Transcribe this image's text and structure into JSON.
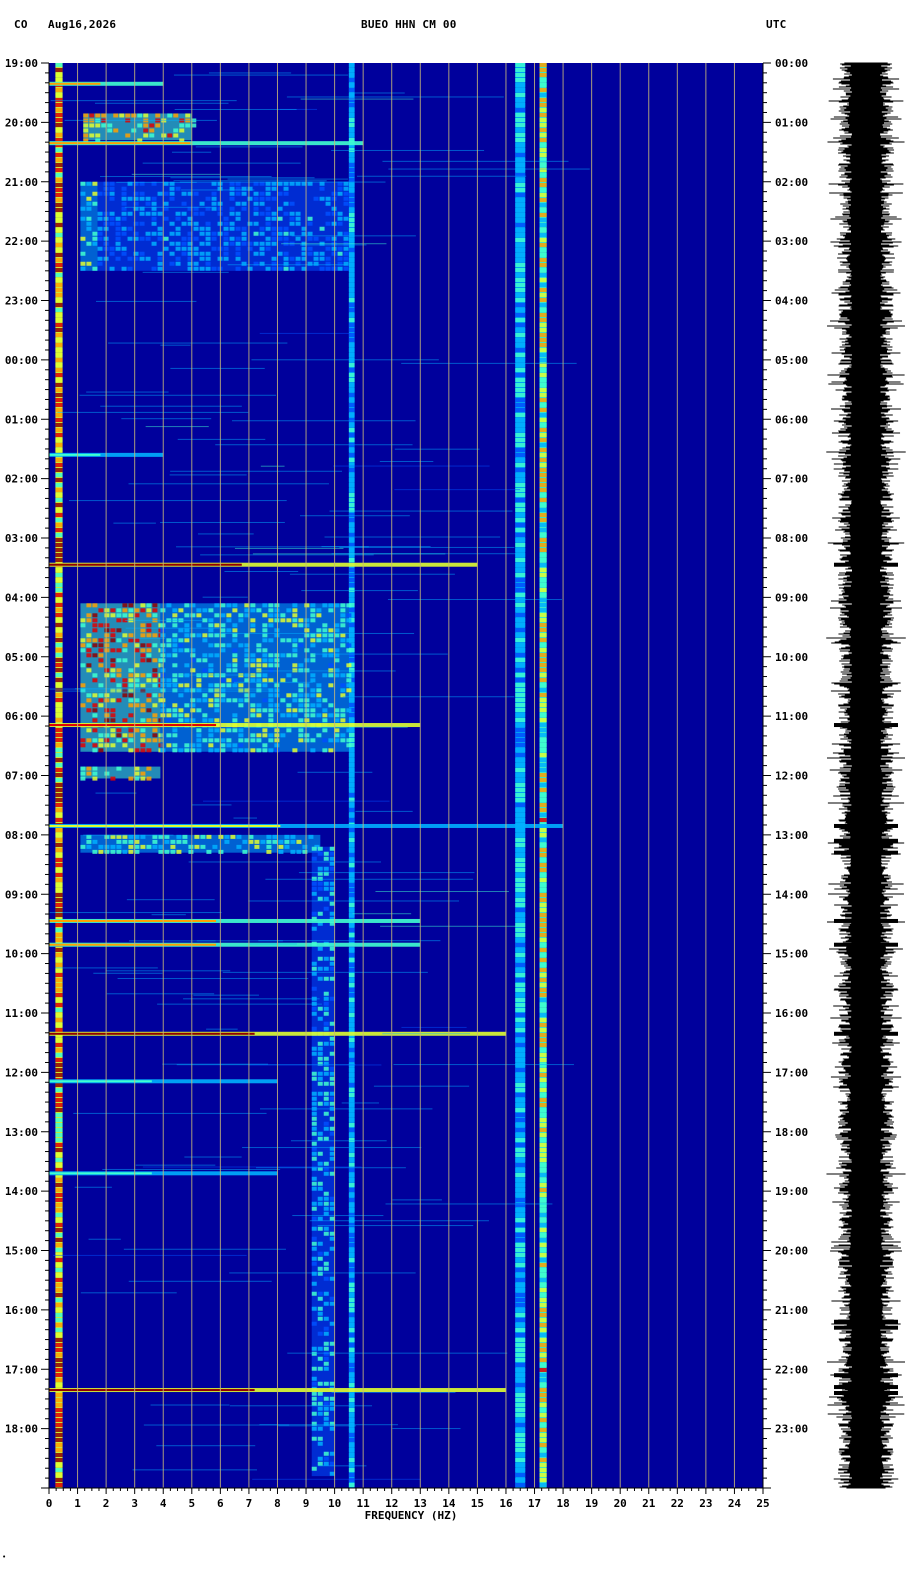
{
  "header": {
    "network": "CO",
    "date": "Aug16,2026",
    "station": "BUEO HHN CM 00",
    "timezone": "UTC"
  },
  "colors": {
    "background": "#00009c",
    "grid": "#c8b878",
    "axis": "#000000",
    "waveform": "#000000",
    "colormap": [
      "#000080",
      "#0010c8",
      "#0050ff",
      "#00b0ff",
      "#40ffd0",
      "#e0ff30",
      "#ffa000",
      "#e00000",
      "#900000"
    ]
  },
  "chart_data": {
    "type": "heatmap",
    "title": "",
    "xlabel": "FREQUENCY (HZ)",
    "ylabel": "",
    "xlim": [
      0,
      25
    ],
    "x_ticks": [
      "0",
      "1",
      "2",
      "3",
      "4",
      "5",
      "6",
      "7",
      "8",
      "9",
      "10",
      "11",
      "12",
      "13",
      "14",
      "15",
      "16",
      "17",
      "18",
      "19",
      "20",
      "21",
      "22",
      "23",
      "24",
      "25"
    ],
    "y_range_hours": [
      0,
      24
    ],
    "left_time_labels": [
      "19:00",
      "20:00",
      "21:00",
      "22:00",
      "23:00",
      "00:00",
      "01:00",
      "02:00",
      "03:00",
      "04:00",
      "05:00",
      "06:00",
      "07:00",
      "08:00",
      "09:00",
      "10:00",
      "11:00",
      "12:00",
      "13:00",
      "14:00",
      "15:00",
      "16:00",
      "17:00",
      "18:00"
    ],
    "right_time_labels": [
      "00:00",
      "01:00",
      "02:00",
      "03:00",
      "04:00",
      "05:00",
      "06:00",
      "07:00",
      "08:00",
      "09:00",
      "10:00",
      "11:00",
      "12:00",
      "13:00",
      "14:00",
      "15:00",
      "16:00",
      "17:00",
      "18:00",
      "19:00",
      "20:00",
      "21:00",
      "22:00",
      "23:00"
    ],
    "grid": true,
    "persistent_bands_hz": [
      {
        "f": 0.35,
        "width": 0.25,
        "level": 0.95
      },
      {
        "f": 17.3,
        "width": 0.25,
        "level": 0.75
      },
      {
        "f": 16.5,
        "width": 0.35,
        "level": 0.5
      },
      {
        "f": 10.6,
        "width": 0.2,
        "level": 0.45
      }
    ],
    "broadband_events": [
      {
        "t_hours": 0.35,
        "fmax": 4.0,
        "level": 0.7
      },
      {
        "t_hours": 1.35,
        "fmax": 11.0,
        "level": 0.75
      },
      {
        "t_hours": 6.6,
        "fmax": 4.0,
        "level": 0.5
      },
      {
        "t_hours": 8.45,
        "fmax": 15.0,
        "level": 0.95
      },
      {
        "t_hours": 11.15,
        "fmax": 13.0,
        "level": 0.9
      },
      {
        "t_hours": 12.85,
        "fmax": 18.0,
        "level": 0.6
      },
      {
        "t_hours": 14.45,
        "fmax": 13.0,
        "level": 0.7
      },
      {
        "t_hours": 14.85,
        "fmax": 13.0,
        "level": 0.8
      },
      {
        "t_hours": 16.35,
        "fmax": 16.0,
        "level": 0.95
      },
      {
        "t_hours": 17.15,
        "fmax": 8.0,
        "level": 0.5
      },
      {
        "t_hours": 18.7,
        "fmax": 8.0,
        "level": 0.5
      },
      {
        "t_hours": 22.35,
        "fmax": 16.0,
        "level": 0.95
      }
    ],
    "energy_patches": [
      {
        "t_start": 0.85,
        "t_end": 1.3,
        "f_start": 1.2,
        "f_end": 5.0,
        "level": 0.8
      },
      {
        "t_start": 2.0,
        "t_end": 3.5,
        "f_start": 1.1,
        "f_end": 1.7,
        "level": 0.6
      },
      {
        "t_start": 2.0,
        "t_end": 3.5,
        "f_start": 1.7,
        "f_end": 10.5,
        "level": 0.4
      },
      {
        "t_start": 9.1,
        "t_end": 11.6,
        "f_start": 1.1,
        "f_end": 3.9,
        "level": 0.9
      },
      {
        "t_start": 9.1,
        "t_end": 11.6,
        "f_start": 3.9,
        "f_end": 10.5,
        "level": 0.55
      },
      {
        "t_start": 11.85,
        "t_end": 12.05,
        "f_start": 1.1,
        "f_end": 3.9,
        "level": 0.8
      },
      {
        "t_start": 13.0,
        "t_end": 13.3,
        "f_start": 1.1,
        "f_end": 9.5,
        "level": 0.6
      },
      {
        "t_start": 13.2,
        "t_end": 23.8,
        "f_start": 9.2,
        "f_end": 10.0,
        "level": 0.5
      }
    ],
    "waveform_spikes_hours": [
      8.45,
      11.15,
      12.85,
      13.1,
      13.3,
      14.45,
      14.85,
      16.35,
      21.2,
      21.3,
      22.1,
      22.3,
      22.4
    ]
  }
}
